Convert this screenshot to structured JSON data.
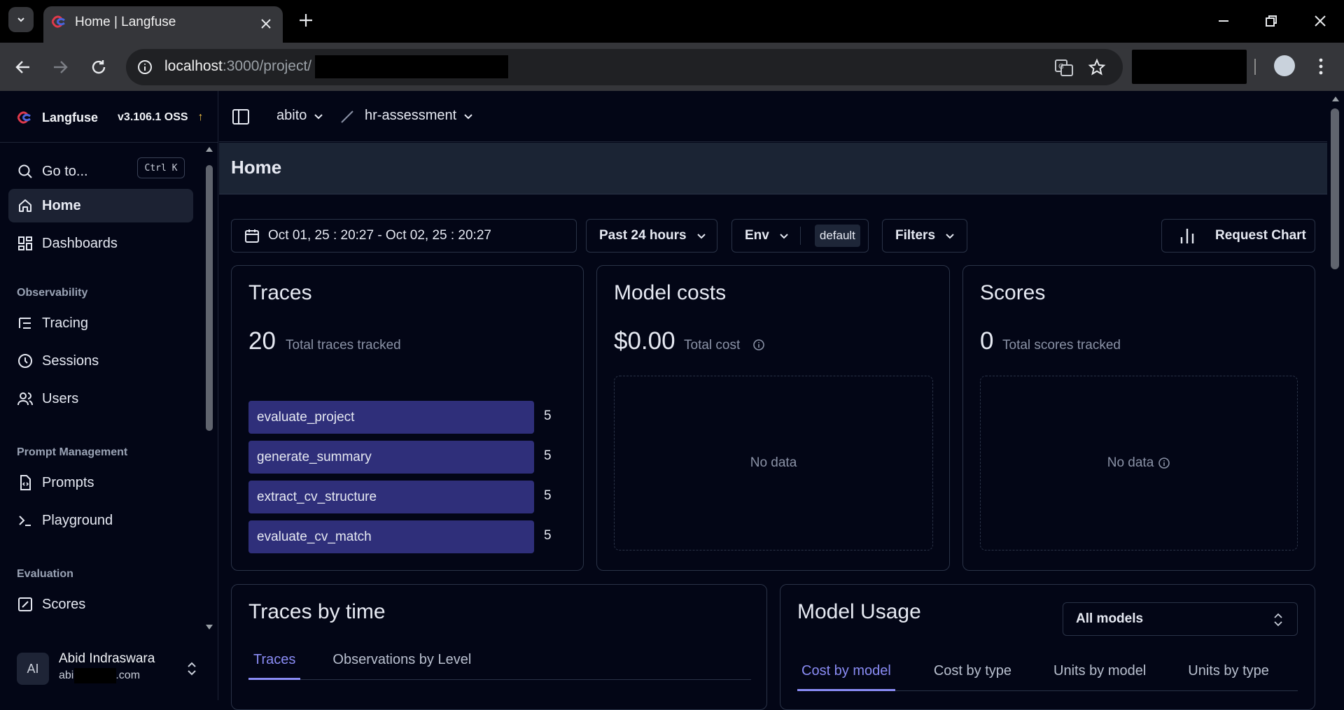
{
  "browser": {
    "tab_title": "Home | Langfuse",
    "url_host": "localhost",
    "url_rest": ":3000/project/"
  },
  "sidebar": {
    "brand": "Langfuse",
    "version": "v3.106.1 OSS",
    "goto_label": "Go to...",
    "goto_shortcut": "Ctrl K",
    "items": {
      "home": "Home",
      "dashboards": "Dashboards",
      "tracing": "Tracing",
      "sessions": "Sessions",
      "users": "Users",
      "prompts": "Prompts",
      "playground": "Playground",
      "scores": "Scores"
    },
    "sections": {
      "observability": "Observability",
      "prompt_management": "Prompt Management",
      "evaluation": "Evaluation"
    },
    "user": {
      "initials": "AI",
      "name": "Abid Indraswara",
      "email_start": "abi",
      "email_end": ".com"
    }
  },
  "topbar": {
    "org": "abito",
    "project": "hr-assessment"
  },
  "page": {
    "title": "Home"
  },
  "filters": {
    "date_range": "Oct 01, 25 : 20:27 - Oct 02, 25 : 20:27",
    "preset": "Past 24 hours",
    "env_label": "Env",
    "env_value": "default",
    "filters_label": "Filters",
    "request_chart": "Request Chart"
  },
  "cards": {
    "traces": {
      "title": "Traces",
      "total": "20",
      "total_label": "Total traces tracked",
      "rows": [
        {
          "name": "evaluate_project",
          "count": "5"
        },
        {
          "name": "generate_summary",
          "count": "5"
        },
        {
          "name": "extract_cv_structure",
          "count": "5"
        },
        {
          "name": "evaluate_cv_match",
          "count": "5"
        }
      ]
    },
    "model_costs": {
      "title": "Model costs",
      "total": "$0.00",
      "total_label": "Total cost",
      "empty": "No data"
    },
    "scores": {
      "title": "Scores",
      "total": "0",
      "total_label": "Total scores tracked",
      "empty": "No data"
    },
    "traces_by_time": {
      "title": "Traces by time",
      "tabs": [
        "Traces",
        "Observations by Level"
      ]
    },
    "model_usage": {
      "title": "Model Usage",
      "select": "All models",
      "tabs": [
        "Cost by model",
        "Cost by type",
        "Units by model",
        "Units by type"
      ]
    }
  },
  "colors": {
    "bg": "#030616",
    "bar": "#2f2f7a",
    "accent": "#8a8cf5",
    "header": "#1b2434"
  }
}
